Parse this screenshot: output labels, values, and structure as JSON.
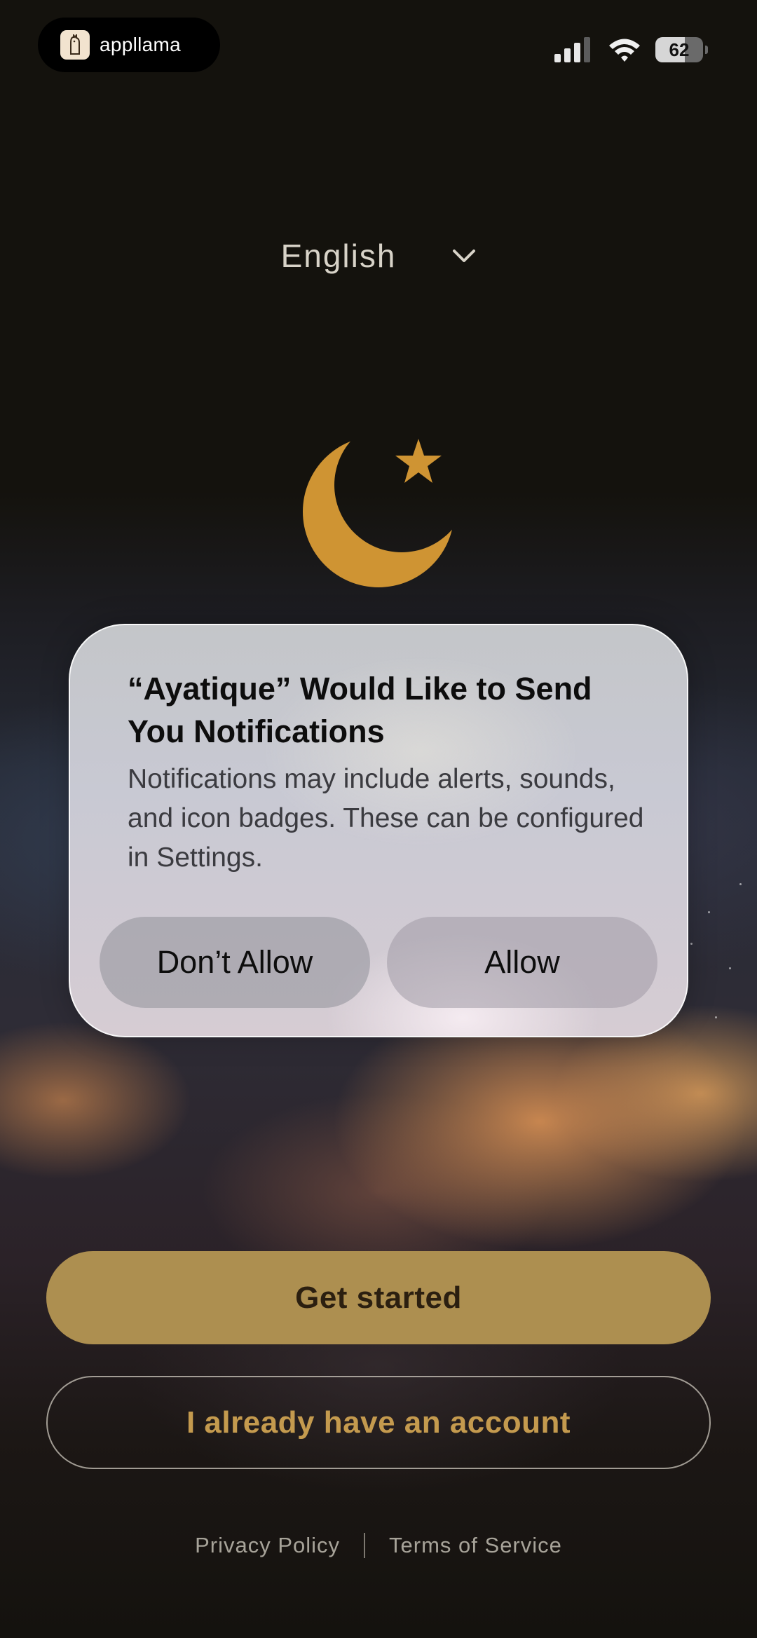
{
  "status_bar": {
    "badge_label": "appllama",
    "battery_level": "62"
  },
  "language": {
    "selected": "English"
  },
  "dialog": {
    "title": "“Ayatique” Would Like to Send You Notifications",
    "body": "Notifications may include alerts, sounds, and icon badges. These can be configured in Settings.",
    "deny_label": "Don’t Allow",
    "allow_label": "Allow"
  },
  "actions": {
    "primary_label": "Get started",
    "secondary_label": "I already have an account"
  },
  "footer": {
    "privacy_label": "Privacy Policy",
    "terms_label": "Terms of Service"
  },
  "colors": {
    "accent_gold": "#ad8f50",
    "moon_gold": "#cf9433",
    "background": "#15130e"
  },
  "icons": [
    "llama-logo-icon",
    "cellular-signal-icon",
    "wifi-icon",
    "battery-icon",
    "chevron-down-icon",
    "crescent-star-icon"
  ]
}
